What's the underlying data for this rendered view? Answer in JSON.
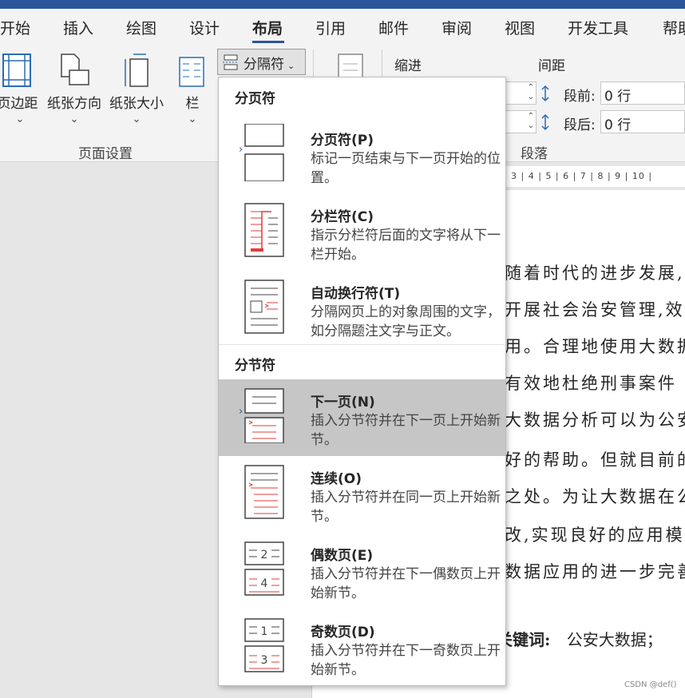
{
  "ribbon_tabs": [
    "开始",
    "插入",
    "绘图",
    "设计",
    "布局",
    "引用",
    "邮件",
    "审阅",
    "视图",
    "开发工具",
    "帮助"
  ],
  "active_tab": "布局",
  "page_setup": {
    "margins_label": "页边距",
    "orientation_label": "纸张方向",
    "size_label": "纸张大小",
    "columns_label": "栏",
    "breaks_label": "分隔符",
    "group_label": "页面设置"
  },
  "paragraph": {
    "indent_label": "缩进",
    "spacing_label": "间距",
    "before_label": "段前:",
    "before_value": "0 行",
    "after_label": "段后:",
    "after_value": "0 行",
    "group_label": "段落"
  },
  "ruler_text": "3 | 4 | 5 | 6 | 7 | 8 | 9 | 10 |",
  "breaks_menu": {
    "page_breaks_header": "分页符",
    "section_breaks_header": "分节符",
    "items": [
      {
        "title": "分页符(P)",
        "desc": "标记一页结束与下一页开始的位置。"
      },
      {
        "title": "分栏符(C)",
        "desc": "指示分栏符后面的文字将从下一栏开始。"
      },
      {
        "title": "自动换行符(T)",
        "desc": "分隔网页上的对象周围的文字，如分隔题注文字与正文。"
      },
      {
        "title": "下一页(N)",
        "desc": "插入分节符并在下一页上开始新节。"
      },
      {
        "title": "连续(O)",
        "desc": "插入分节符并在同一页上开始新节。"
      },
      {
        "title": "偶数页(E)",
        "desc": "插入分节符并在下一偶数页上开始新节。"
      },
      {
        "title": "奇数页(D)",
        "desc": "插入分节符并在下一奇数页上开始新节。"
      }
    ],
    "highlighted_item": "下一页(N)"
  },
  "document_lines": [
    "随着时代的进步发展,对",
    "开展社会治安管理,效",
    "用。合理地使用大数据",
    "有效地杜绝刑事案件",
    "大数据分析可以为公安",
    "好的帮助。但就目前的",
    "之处。为让大数据在公",
    "改,实现良好的应用模",
    "数据应用的进一步完善"
  ],
  "keywords": {
    "label": "关键词:",
    "value": "公安大数据；"
  },
  "watermark": "CSDN @def()",
  "colors": {
    "accent": "#2b579a",
    "highlight": "#c6c6c6",
    "icon_red": "#e03c3c"
  }
}
